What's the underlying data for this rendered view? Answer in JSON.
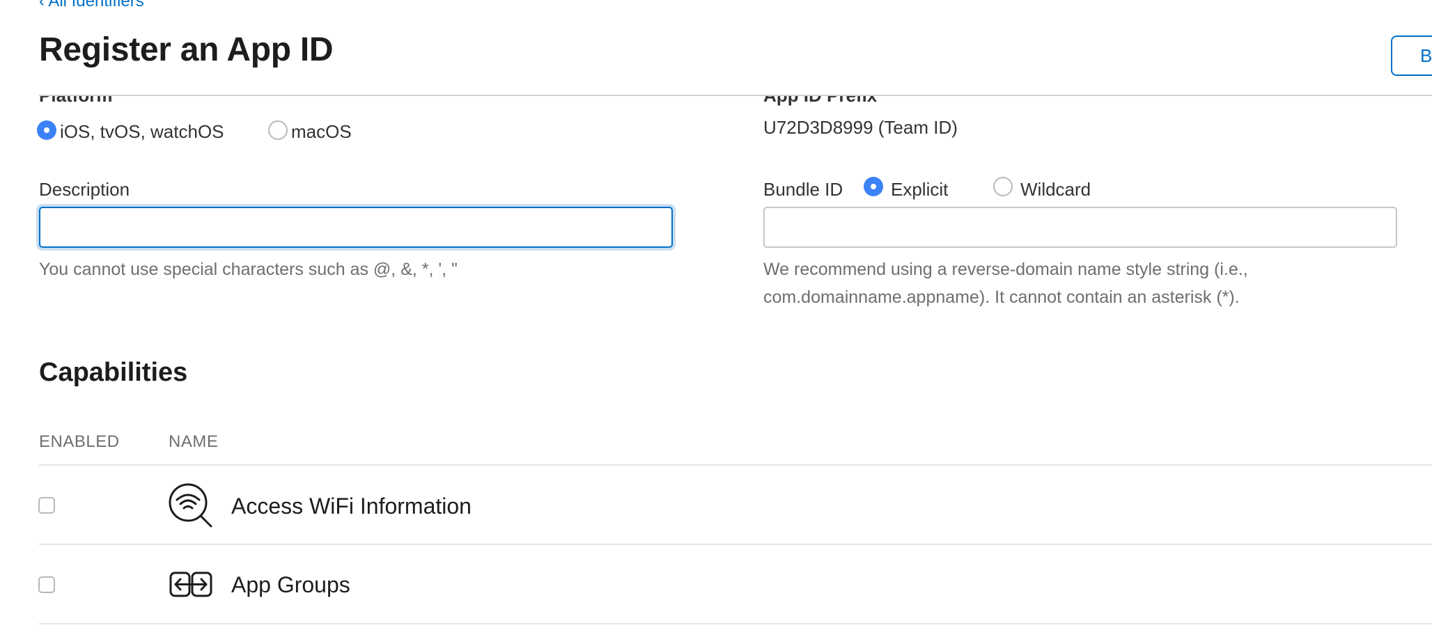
{
  "nav": {
    "back_label": "‹ All Identifiers"
  },
  "header": {
    "title": "Register an App ID",
    "button_label": "Back"
  },
  "platform": {
    "label": "Platform",
    "options": [
      {
        "label": "iOS, tvOS, watchOS",
        "selected": true
      },
      {
        "label": "macOS",
        "selected": false
      }
    ]
  },
  "prefix": {
    "label": "App ID Prefix",
    "value": "U72D3D8999 (Team ID)"
  },
  "description": {
    "label": "Description",
    "value": "",
    "placeholder": "",
    "helper": "You cannot use special characters such as @, &, *, ', \""
  },
  "bundle": {
    "label": "Bundle ID",
    "options": [
      {
        "label": "Explicit",
        "selected": true
      },
      {
        "label": "Wildcard",
        "selected": false
      }
    ],
    "value": "",
    "placeholder": "",
    "helper_line1": "We recommend using a reverse-domain name style string (i.e.,",
    "helper_line2": "com.domainname.appname). It cannot contain an asterisk (*)."
  },
  "capabilities": {
    "title": "Capabilities",
    "columns": {
      "enabled": "ENABLED",
      "name": "NAME"
    },
    "rows": [
      {
        "name": "Access WiFi Information",
        "enabled": false,
        "icon": "wifi-search-icon"
      },
      {
        "name": "App Groups",
        "enabled": false,
        "icon": "app-groups-icon"
      }
    ]
  },
  "colors": {
    "accent": "#0070c9",
    "radio_selected": "#3b82f6",
    "text": "#1d1d1f",
    "muted": "#6e6e73"
  }
}
